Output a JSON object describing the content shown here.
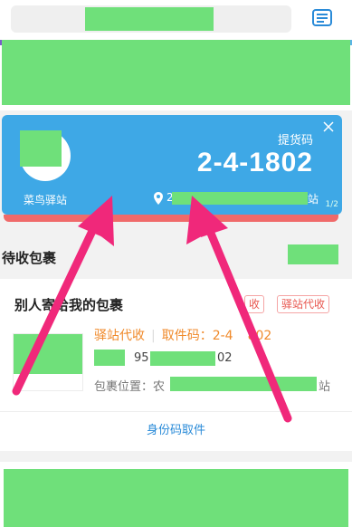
{
  "header": {
    "search_icon": "search-icon",
    "menu_icon": "list-menu-icon"
  },
  "pickup_card": {
    "station_name": "菜鸟驿站",
    "pickup_label": "提货码",
    "pickup_code": "2-4-1802",
    "address_start": "2",
    "address_end": "站",
    "page_indicator": "1/2",
    "close_icon": "close-icon",
    "location_icon": "location-pin-icon"
  },
  "section": {
    "title": "待收包裹"
  },
  "package": {
    "title": "别人寄给我的包裹",
    "tags": [
      "收",
      "驿站代收"
    ],
    "status": "驿站代收",
    "code_label": "取件码：2-4",
    "code_suffix": "802",
    "tracking_prefix": "95",
    "tracking_suffix": "02",
    "location_label": "包裹位置：农",
    "location_suffix": "站",
    "id_pickup_button": "身份码取件"
  },
  "colors": {
    "accent_blue": "#3ea8e6",
    "arrow_pink": "#f0287a",
    "orange": "#f08a2b"
  }
}
